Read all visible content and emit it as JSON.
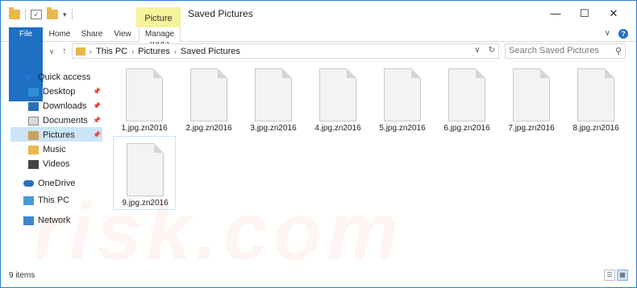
{
  "window": {
    "title": "Saved Pictures",
    "picture_tools": "Picture Tools",
    "controls": {
      "minimize": "—",
      "maximize": "☐",
      "close": "✕"
    }
  },
  "ribbon": {
    "tabs": [
      "File",
      "Home",
      "Share",
      "View",
      "Manage"
    ],
    "expand": "∨",
    "help": "?"
  },
  "nav": {
    "back": "←",
    "forward": "→",
    "recent": "∨",
    "up": "↑",
    "breadcrumb": [
      "This PC",
      "Pictures",
      "Saved Pictures"
    ],
    "address_dropdown": "∨",
    "refresh": "↻",
    "search_placeholder": "Search Saved Pictures",
    "search_icon": "search-icon"
  },
  "sidebar": {
    "quick_access": "Quick access",
    "items": [
      {
        "label": "Desktop",
        "pinned": true
      },
      {
        "label": "Downloads",
        "pinned": true
      },
      {
        "label": "Documents",
        "pinned": true
      },
      {
        "label": "Pictures",
        "pinned": true
      },
      {
        "label": "Music",
        "pinned": false
      },
      {
        "label": "Videos",
        "pinned": false
      }
    ],
    "onedrive": "OneDrive",
    "this_pc": "This PC",
    "network": "Network"
  },
  "files": [
    "1.jpg.zn2016",
    "2.jpg.zn2016",
    "3.jpg.zn2016",
    "4.jpg.zn2016",
    "5.jpg.zn2016",
    "6.jpg.zn2016",
    "7.jpg.zn2016",
    "8.jpg.zn2016",
    "9.jpg.zn2016"
  ],
  "status": {
    "item_count": "9 items"
  },
  "colors": {
    "accent": "#1f6fc5",
    "selection": "#cce4f7",
    "picture_tools_highlight": "#f7f39a"
  }
}
